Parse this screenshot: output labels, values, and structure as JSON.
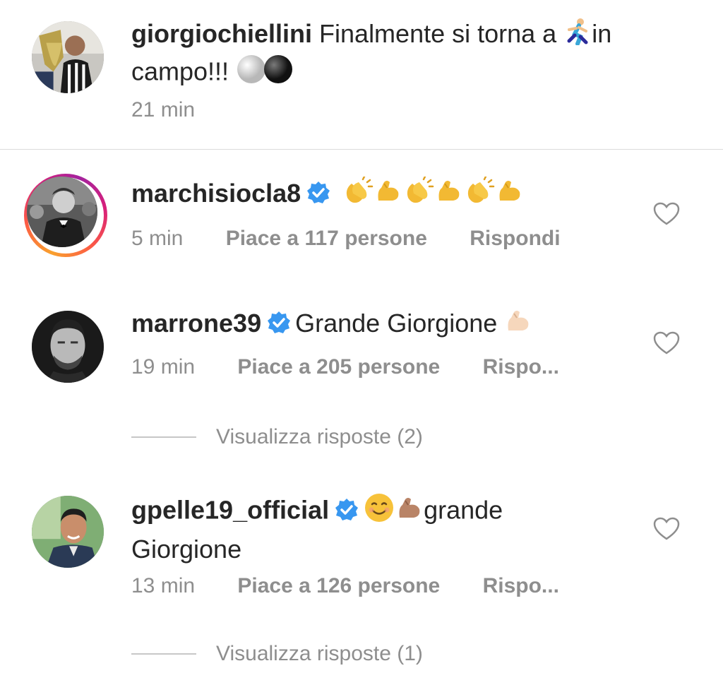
{
  "post": {
    "username": "giorgiochiellini",
    "caption_1": "Finalmente si torna a",
    "caption_1_end": "in",
    "caption_2": "campo!!!",
    "time": "21 min",
    "emoji_runner": "runner-emoji",
    "emoji_balls": [
      "white-ball-emoji",
      "black-ball-emoji"
    ]
  },
  "comments": [
    {
      "username": "marchisiocla8",
      "verified": true,
      "emojis": [
        "clap",
        "muscle",
        "clap",
        "muscle",
        "clap",
        "muscle"
      ],
      "time": "5 min",
      "likes": "Piace a 117 persone",
      "reply": "Rispondi",
      "story_ring": true
    },
    {
      "username": "marrone39",
      "verified": true,
      "text": "Grande Giorgione",
      "time": "19 min",
      "likes": "Piace a 205 persone",
      "reply": "Rispo...",
      "view_replies": "Visualizza risposte (2)"
    },
    {
      "username": "gpelle19_official",
      "verified": true,
      "text_1": "grande",
      "text_2": "Giorgione",
      "time": "13 min",
      "likes": "Piace a 126 persone",
      "reply": "Rispo...",
      "view_replies": "Visualizza risposte (1)"
    }
  ],
  "colors": {
    "text": "#262626",
    "meta": "#8e8e8e",
    "verified": "#3897f0",
    "divider": "#dbdbdb"
  }
}
